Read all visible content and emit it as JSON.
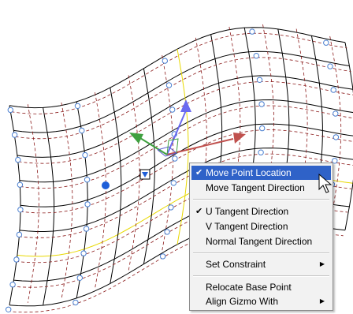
{
  "menu": {
    "items": [
      {
        "label": "Move Point Location",
        "checked": true,
        "submenu": false,
        "highlighted": true
      },
      {
        "label": "Move Tangent Direction",
        "checked": false,
        "submenu": false,
        "highlighted": false
      },
      {
        "label": "U Tangent Direction",
        "checked": true,
        "submenu": false,
        "highlighted": false
      },
      {
        "label": "V Tangent Direction",
        "checked": false,
        "submenu": false,
        "highlighted": false
      },
      {
        "label": "Normal Tangent Direction",
        "checked": false,
        "submenu": false,
        "highlighted": false
      },
      {
        "label": "Set Constraint",
        "checked": false,
        "submenu": true,
        "highlighted": false
      },
      {
        "label": "Relocate Base Point",
        "checked": false,
        "submenu": false,
        "highlighted": false
      },
      {
        "label": "Align Gizmo With",
        "checked": false,
        "submenu": true,
        "highlighted": false
      }
    ],
    "check_glyph": "✔",
    "submenu_glyph": "▶"
  },
  "gizmo": {
    "axis_colors": {
      "x": "#c0504d",
      "y": "#3fa03f",
      "z": "#6a6af0"
    },
    "grip_color": "#1e5ed8"
  },
  "surface": {
    "line_color": "#000000",
    "hidden_line_color": "#8b1a1a",
    "highlight_color": "#e8d800",
    "vertex_color": "#4a7fd0"
  }
}
